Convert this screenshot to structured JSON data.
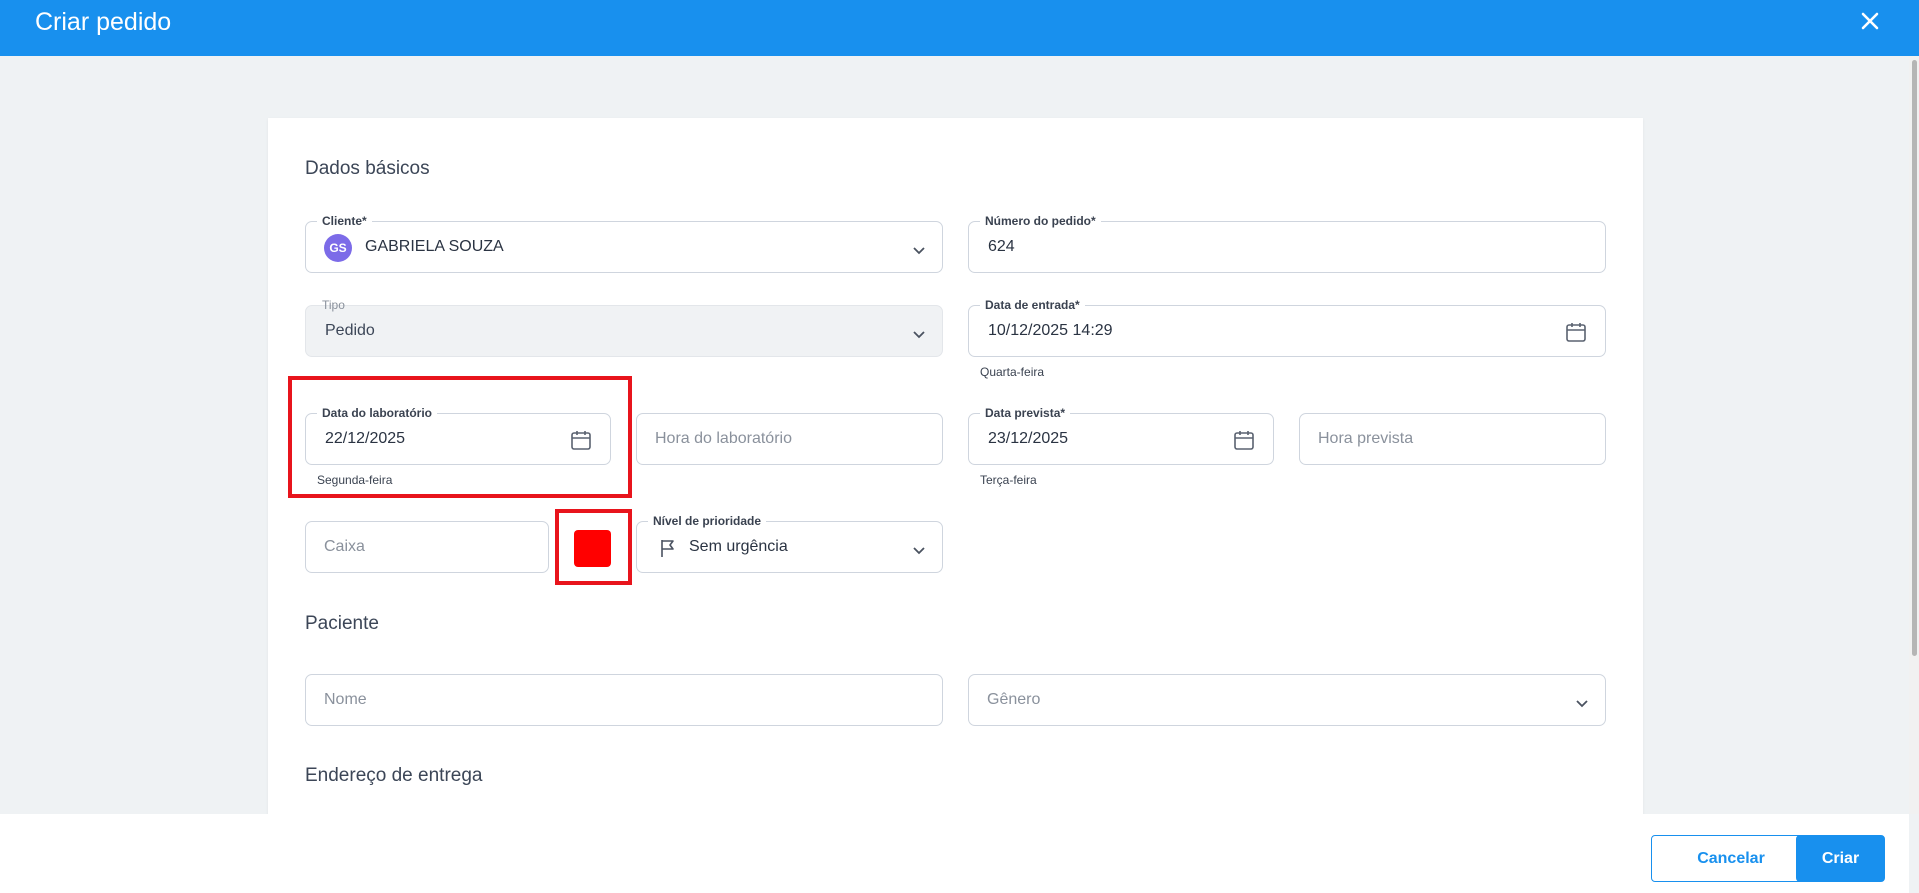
{
  "header": {
    "title": "Criar pedido",
    "close_icon": "close-icon"
  },
  "sections": {
    "basic": "Dados básicos",
    "patient": "Paciente",
    "delivery": "Endereço de entrega"
  },
  "fields": {
    "cliente": {
      "label": "Cliente*",
      "value": "GABRIELA SOUZA",
      "avatar": "GS"
    },
    "numero_pedido": {
      "label": "Número do pedido*",
      "value": "624"
    },
    "tipo": {
      "label": "Tipo",
      "value": "Pedido"
    },
    "data_entrada": {
      "label": "Data de entrada*",
      "value": "10/12/2025 14:29",
      "hint": "Quarta-feira"
    },
    "data_laboratorio": {
      "label": "Data do laboratório",
      "value": "22/12/2025",
      "hint": "Segunda-feira"
    },
    "hora_laboratorio": {
      "placeholder": "Hora do laboratório"
    },
    "data_prevista": {
      "label": "Data prevista*",
      "value": "23/12/2025",
      "hint": "Terça-feira"
    },
    "hora_prevista": {
      "placeholder": "Hora prevista"
    },
    "caixa": {
      "placeholder": "Caixa"
    },
    "cor": {
      "color": "#ff0000"
    },
    "prioridade": {
      "label": "Nível de prioridade",
      "value": "Sem urgência"
    },
    "nome": {
      "placeholder": "Nome"
    },
    "genero": {
      "placeholder": "Gênero"
    }
  },
  "footer": {
    "cancel_label": "Cancelar",
    "create_label": "Criar"
  },
  "colors": {
    "accent": "#1890ee",
    "highlight": "#e8141c",
    "avatar": "#7c6be8"
  }
}
